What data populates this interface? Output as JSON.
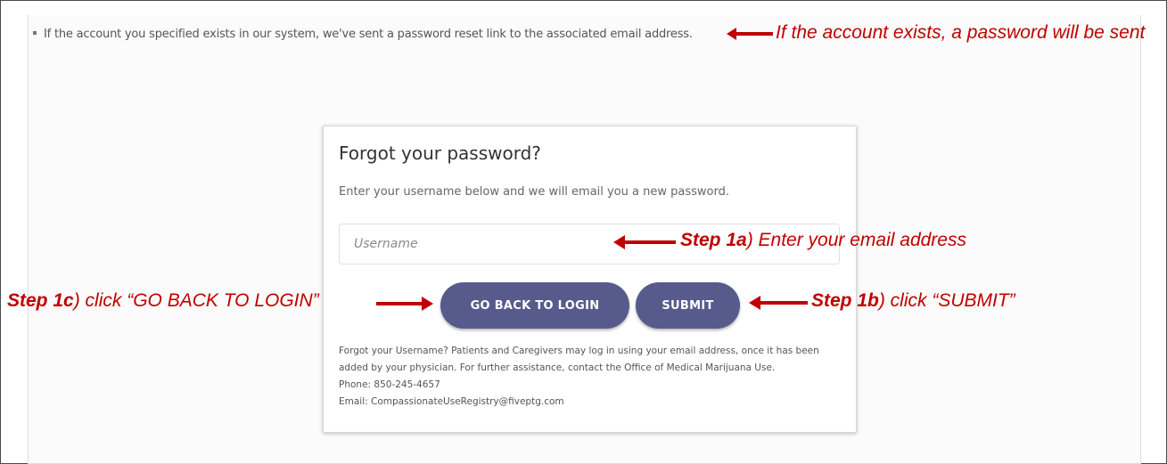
{
  "notice": {
    "text": "If the account you specified exists in our system, we've sent a password reset link to the associated email address."
  },
  "annotations": {
    "notice_note": "If the account exists, a password will be sent",
    "step1a_label": "Step 1a",
    "step1a_text": ") Enter your email address",
    "step1b_label": "Step 1b",
    "step1b_text": ") click “SUBMIT”",
    "step1c_label": "Step 1c",
    "step1c_text": ") click “GO BACK TO LOGIN”",
    "color": "#c00000"
  },
  "form": {
    "title": "Forgot your password?",
    "subtitle": "Enter your username below and we will email you a new password.",
    "username_placeholder": "Username",
    "username_value": "",
    "back_button": "GO BACK TO LOGIN",
    "submit_button": "SUBMIT",
    "button_color": "#575b8c"
  },
  "help": {
    "line1": "Forgot your Username? Patients and Caregivers may log in using your email address, once it has been",
    "line2": "added by your physician. For further assistance, contact the Office of Medical Marijuana Use.",
    "phone": "Phone: 850-245-4657",
    "email": "Email: CompassionateUseRegistry@fiveptg.com"
  },
  "icons": {
    "bullet": "square-bullet-icon",
    "arrow": "red-arrow-icon"
  }
}
